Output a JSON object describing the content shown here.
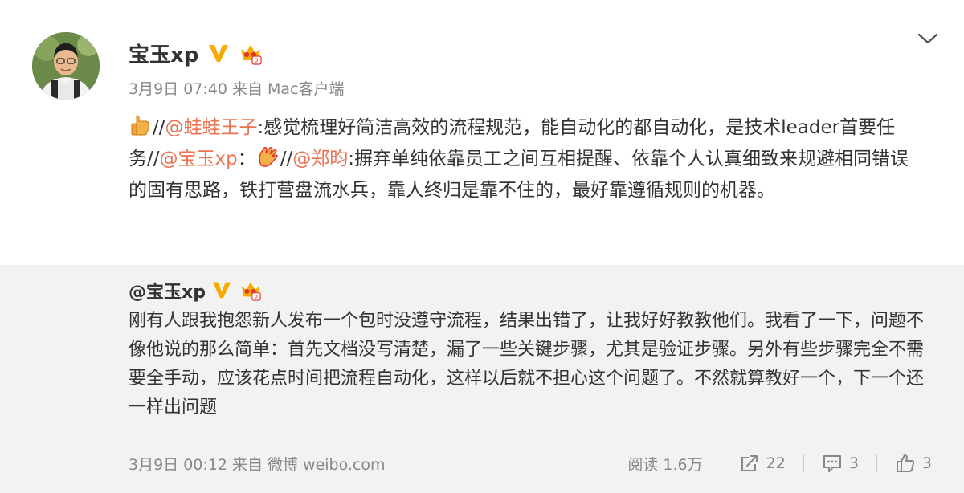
{
  "post": {
    "author": "宝玉xp",
    "time": "3月9日 07:40",
    "via": "来自",
    "client": "Mac客户端",
    "text": {
      "sep1": "//",
      "mention1": "@蛙蛙王子",
      "seg1": ":感觉梳理好简洁高效的流程规范，能自动化的都自动化，是技术leader首要任务//",
      "mention2": "@宝玉xp",
      "seg2": "：",
      "sep2": "//",
      "mention3": "@郑昀",
      "seg3": ":摒弃单纯依靠员工之间互相提醒、依靠个人认真细致来规避相同错误的固有思路，铁打营盘流水兵，靠人终归是靠不住的，最好靠遵循规则的机器。"
    }
  },
  "quoted": {
    "author": "@宝玉xp",
    "text": "刚有人跟我抱怨新人发布一个包时没遵守流程，结果出错了，让我好好教教他们。我看了一下，问题不像他说的那么简单：首先文档没写清楚，漏了一些关键步骤，尤其是验证步骤。另外有些步骤完全不需要全手动，应该花点时间把流程自动化，这样以后就不担心这个问题了。不然就算教好一个，下一个还一样出问题",
    "time": "3月9日 00:12",
    "via": "来自",
    "client": "微博 weibo.com",
    "reads": "阅读 1.6万",
    "reposts": "22",
    "comments": "3",
    "likes": "3"
  },
  "icons": {
    "more": "chevron-down-icon",
    "verified": "verified-v-icon",
    "member": "crown-badge-icon",
    "thumbs_up_emoji": "thumbs-up-emoji-icon",
    "clap_emoji": "clap-emoji-icon",
    "repost": "repost-icon",
    "comment": "comment-icon",
    "like": "like-icon"
  },
  "colors": {
    "mention": "#eb7350",
    "verified": "#f7ab00",
    "text": "#333333",
    "meta": "#888888",
    "quoted_bg": "#f2f2f2"
  }
}
